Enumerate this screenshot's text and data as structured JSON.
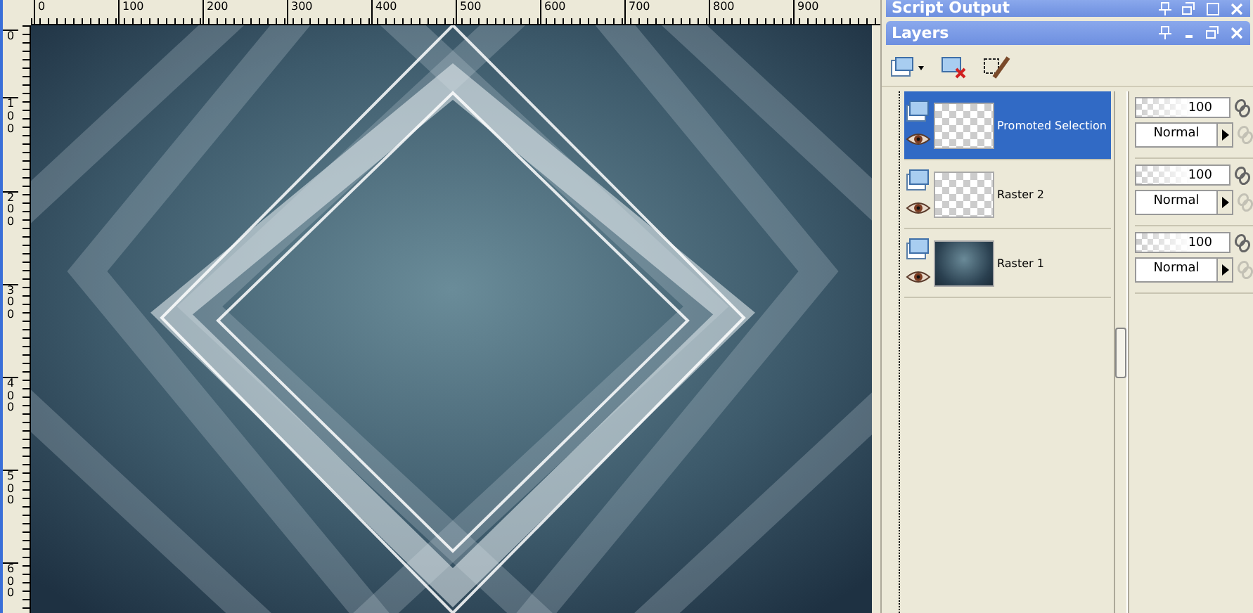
{
  "rulers": {
    "horizontal": [
      "0",
      "100",
      "200",
      "300",
      "400",
      "500",
      "600",
      "700",
      "800",
      "900"
    ],
    "vertical": [
      "0",
      "100",
      "200",
      "300",
      "400",
      "500",
      "600"
    ]
  },
  "script_output": {
    "title": "Script Output"
  },
  "layers": {
    "title": "Layers",
    "items": [
      {
        "name": "Promoted Selection",
        "selected": true,
        "kind": "transparent",
        "visible": true,
        "opacity": "100",
        "blend_mode": "Normal"
      },
      {
        "name": "Raster 2",
        "selected": false,
        "kind": "transparent",
        "visible": true,
        "opacity": "100",
        "blend_mode": "Normal"
      },
      {
        "name": "Raster 1",
        "selected": false,
        "kind": "image",
        "visible": true,
        "opacity": "100",
        "blend_mode": "Normal"
      }
    ]
  }
}
